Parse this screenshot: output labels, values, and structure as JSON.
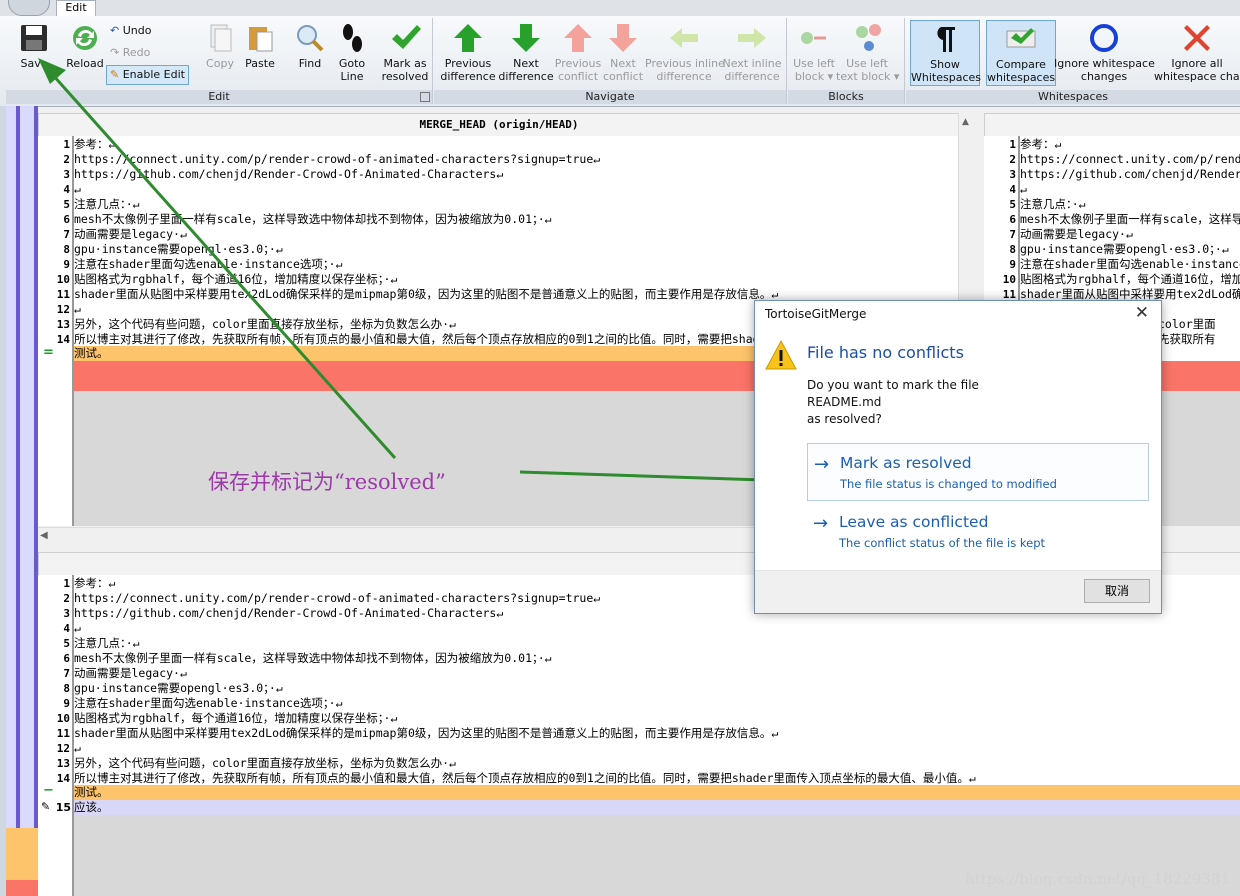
{
  "ribbon": {
    "tab": "Edit",
    "groups": {
      "edit": "Edit",
      "navigate": "Navigate",
      "blocks": "Blocks",
      "whitespaces": "Whitespaces"
    },
    "buttons": {
      "save": "Save",
      "reload": "Reload",
      "undo": "Undo",
      "redo": "Redo",
      "enable_edit": "Enable Edit",
      "copy": "Copy",
      "paste": "Paste",
      "find": "Find",
      "goto_line": "Goto\nLine",
      "mark_resolved": "Mark as\nresolved",
      "prev_diff": "Previous\ndifference",
      "next_diff": "Next\ndifference",
      "prev_conflict": "Previous\nconflict",
      "next_conflict": "Next\nconflict",
      "prev_inline": "Previous inline\ndifference",
      "next_inline": "Next inline\ndifference",
      "use_left_block": "Use left\nblock ▾",
      "use_left_text_block": "Use left\ntext block ▾",
      "show_ws": "Show\nWhitespaces",
      "compare_ws": "Compare\nwhitespaces",
      "ignore_ws_changes": "Ignore whitespace\nchanges",
      "ignore_all": "Ignore all\nwhitespace chan"
    }
  },
  "panes": {
    "left_title": "MERGE_HEAD (origin/HEAD)",
    "lines": [
      {
        "n": "1",
        "t": "参考：↵"
      },
      {
        "n": "2",
        "t": "https://connect.unity.com/p/render-crowd-of-animated-characters?signup=true↵"
      },
      {
        "n": "3",
        "t": "https://github.com/chenjd/Render-Crowd-Of-Animated-Characters↵"
      },
      {
        "n": "4",
        "t": "↵"
      },
      {
        "n": "5",
        "t": "注意几点：·↵"
      },
      {
        "n": "6",
        "t": "mesh不太像例子里面一样有scale，这样导致选中物体却找不到物体，因为被缩放为0.01；·↵"
      },
      {
        "n": "7",
        "t": "动画需要是legacy·↵"
      },
      {
        "n": "8",
        "t": "gpu·instance需要opengl·es3.0；·↵"
      },
      {
        "n": "9",
        "t": "注意在shader里面勾选enable·instance选项；·↵"
      },
      {
        "n": "10",
        "t": "贴图格式为rgbhalf，每个通道16位，增加精度以保存坐标；·↵"
      },
      {
        "n": "11",
        "t": "shader里面从贴图中采样要用tex2dLod确保采样的是mipmap第0级，因为这里的贴图不是普通意义上的贴图，而主要作用是存放信息。↵"
      },
      {
        "n": "12",
        "t": "↵"
      },
      {
        "n": "13",
        "t": "另外，这个代码有些问题，color里面直接存放坐标，坐标为负数怎么办·↵"
      },
      {
        "n": "14",
        "t": "所以博主对其进行了修改，先获取所有帧，所有顶点的最小值和最大值，然后每个顶点存放相应的0到1之间的比值。同时，需要把shader里面传入顶点坐标的最大值、最小值。↵"
      }
    ],
    "left_extra": "测试。",
    "right_line14": "所以博主对其进行了修改，先获取所有",
    "right_line13": "另外，这个代码有些问题，color里面",
    "bottom_extra_1": "测试。",
    "bottom_line_15_n": "15",
    "bottom_line_15": "应该。"
  },
  "dialog": {
    "title": "TortoiseGitMerge",
    "close": "✕",
    "heading": "File has no conflicts",
    "message": [
      "Do you want to mark the file",
      "README.md",
      "as resolved?"
    ],
    "commands": [
      {
        "title": "Mark as resolved",
        "desc": "The file status is changed to modified"
      },
      {
        "title": "Leave as conflicted",
        "desc": "The conflict status of the file is kept"
      }
    ],
    "cancel": "取消"
  },
  "annotation": "保存并标记为“resolved”",
  "watermark": "https://blog.csdn.net/qq_18229381",
  "colors": {
    "accent": "#1c5fb0",
    "conflict_red": "#fb7468",
    "modified_orange": "#fdc46b",
    "annotation": "#9b3aa8",
    "arrow_green": "#2e8b2e"
  }
}
